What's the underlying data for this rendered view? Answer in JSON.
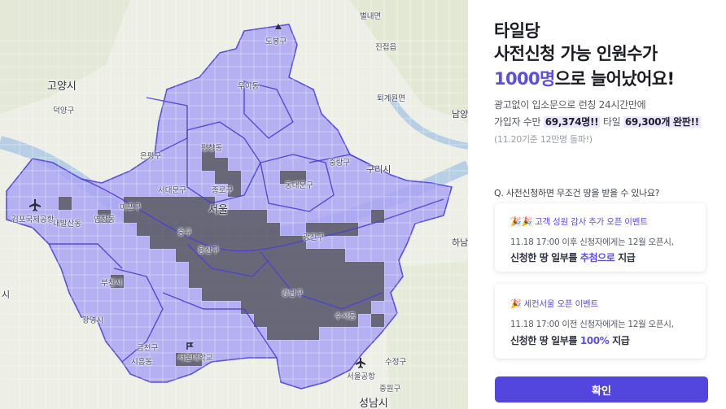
{
  "map": {
    "labels": [
      {
        "text": "별내면",
        "cls": "small"
      },
      {
        "text": "진접읍",
        "cls": "small"
      },
      {
        "text": "도봉구",
        "cls": "small"
      },
      {
        "text": "우이동",
        "cls": "small"
      },
      {
        "text": "퇴계원면",
        "cls": "small"
      },
      {
        "text": "고양시",
        "cls": "big"
      },
      {
        "text": "덕양구",
        "cls": "small"
      },
      {
        "text": "남양",
        "cls": ""
      },
      {
        "text": "평창동",
        "cls": "small"
      },
      {
        "text": "은평구",
        "cls": "small"
      },
      {
        "text": "중랑구",
        "cls": "small"
      },
      {
        "text": "구리시",
        "cls": ""
      },
      {
        "text": "서대문구",
        "cls": "small"
      },
      {
        "text": "동대문구",
        "cls": "small"
      },
      {
        "text": "종로구",
        "cls": "small"
      },
      {
        "text": "마포구",
        "cls": "small"
      },
      {
        "text": "서울",
        "cls": "big"
      },
      {
        "text": "김포국제공항",
        "cls": "small"
      },
      {
        "text": "내발산동",
        "cls": "small"
      },
      {
        "text": "염창동",
        "cls": "small"
      },
      {
        "text": "광진구",
        "cls": "small"
      },
      {
        "text": "하남",
        "cls": ""
      },
      {
        "text": "중구",
        "cls": "small"
      },
      {
        "text": "용산구",
        "cls": "small"
      },
      {
        "text": "부천시",
        "cls": "small"
      },
      {
        "text": "강남구",
        "cls": "small"
      },
      {
        "text": "시",
        "cls": ""
      },
      {
        "text": "수서동",
        "cls": "small"
      },
      {
        "text": "광명시",
        "cls": "small"
      },
      {
        "text": "금천구",
        "cls": "small"
      },
      {
        "text": "시흥동",
        "cls": "small"
      },
      {
        "text": "서울대학교",
        "cls": "small"
      },
      {
        "text": "수정구",
        "cls": "small"
      },
      {
        "text": "서울공항",
        "cls": "small"
      },
      {
        "text": "중원구",
        "cls": "small"
      },
      {
        "text": "성남시",
        "cls": "big"
      }
    ]
  },
  "panel": {
    "title_line1": "타일당",
    "title_line2": "사전신청 가능 인원수가",
    "title_accent": "1000명",
    "title_rest": "으로 늘어났어요!",
    "desc_line1": "광고없이 입소문으로 런칭 24시간만에",
    "desc_line2_a": "가입자 수만 ",
    "desc_line2_b": "69,374명!!",
    "desc_line2_c": "  타일 ",
    "desc_line2_d": "69,300개 완판!!",
    "note": "(11.20기준 12만명 돌파!)",
    "question": "Q. 사전신청하면 무조건 땅을 받을 수 있나요?",
    "cards": [
      {
        "title": "고객 성원 감사 추가 오픈 이벤트",
        "body": "11.18 17:00 이후 신청자에게는 12월 오픈시,",
        "strong_a": "신청한 땅 일부를 ",
        "strong_b": "추첨으로",
        "strong_c": " 지급"
      },
      {
        "title": "세컨서울 오픈 이벤트",
        "body": "11.18 17:00 이전 신청자에게는 12월 오픈시,",
        "strong_a": "신청한 땅 일부를 ",
        "strong_b": "100%",
        "strong_c": " 지급"
      }
    ],
    "confirm_label": "확인"
  },
  "colors": {
    "accent": "#5246df",
    "tile_light": "#a9a5f2",
    "tile_dark": "#5d5c66"
  }
}
